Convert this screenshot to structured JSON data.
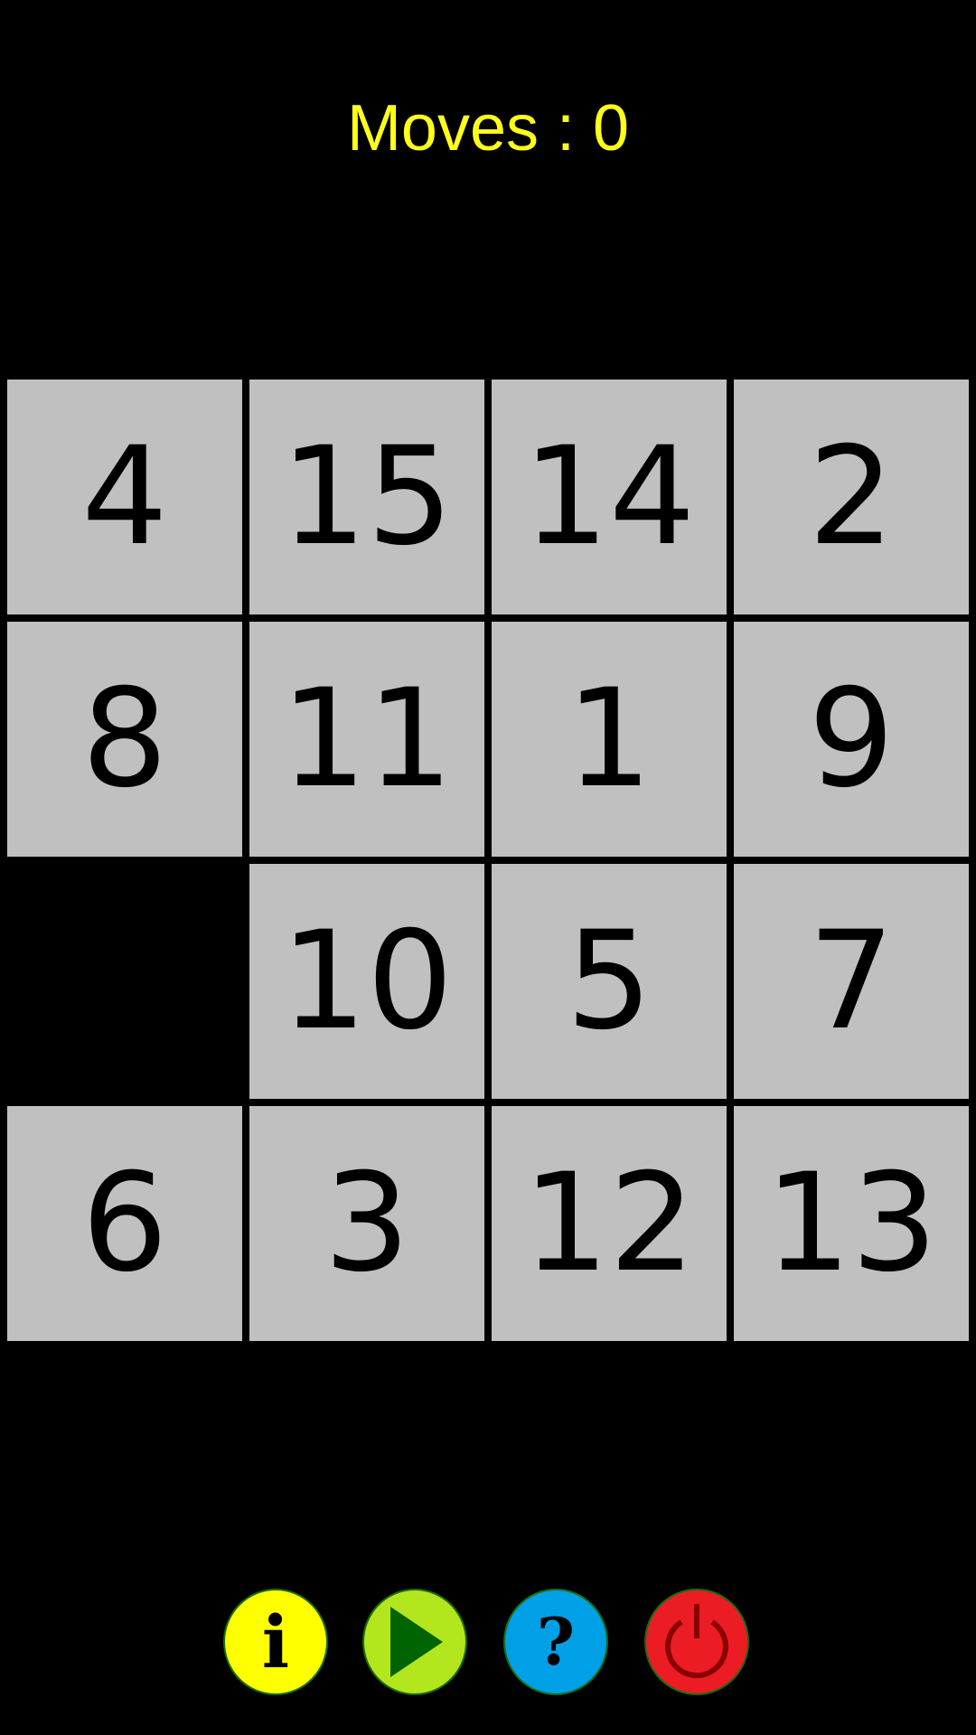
{
  "header": {
    "moves_label": "Moves : 0",
    "moves": 0
  },
  "board": {
    "size": 4,
    "tiles": [
      [
        "4",
        "15",
        "14",
        "2"
      ],
      [
        "8",
        "11",
        "1",
        "9"
      ],
      [
        "",
        "10",
        "5",
        "7"
      ],
      [
        "6",
        "3",
        "12",
        "13"
      ]
    ],
    "empty_position": {
      "row": 2,
      "col": 0
    }
  },
  "buttons": [
    {
      "name": "info",
      "icon": "info-icon",
      "glyph": "i",
      "color": "#ffff00"
    },
    {
      "name": "play",
      "icon": "play-icon",
      "glyph": "▶",
      "color": "#b4e61e"
    },
    {
      "name": "help",
      "icon": "help-icon",
      "glyph": "?",
      "color": "#00a0e6"
    },
    {
      "name": "quit",
      "icon": "power-icon",
      "glyph": "⏻",
      "color": "#ec1c24"
    }
  ],
  "colors": {
    "moves_text": "#ffff1a",
    "tile": "#c0c0c0",
    "background": "#000000"
  }
}
